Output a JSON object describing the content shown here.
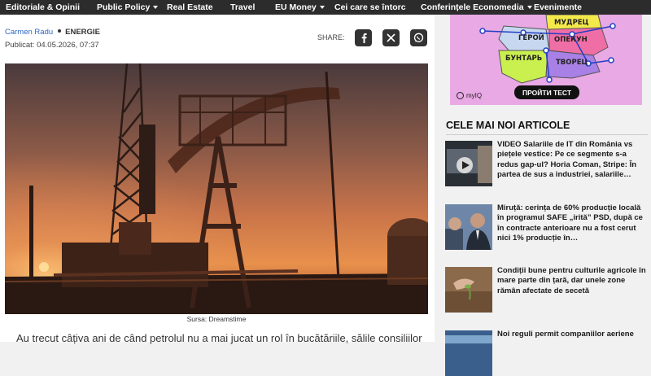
{
  "nav": {
    "items": [
      {
        "label": "Editoriale & Opinii",
        "dropdown": false
      },
      {
        "label": "Public Policy",
        "dropdown": true
      },
      {
        "label": "Real Estate",
        "dropdown": false
      },
      {
        "label": "Travel",
        "dropdown": false
      },
      {
        "label": "EU Money",
        "dropdown": true
      },
      {
        "label": "Cei care se întorc",
        "dropdown": false
      },
      {
        "label": "Conferințele Economedia",
        "dropdown": true
      },
      {
        "label": "Evenimente",
        "dropdown": false
      }
    ]
  },
  "article": {
    "author": "Carmen Radu",
    "category": "ENERGIE",
    "published": "Publicat: 04.05.2026, 07:37",
    "share_label": "SHARE:",
    "share_icons": [
      "facebook-icon",
      "x-icon",
      "whatsapp-icon"
    ],
    "image_caption": "Sursa: Dreamstime",
    "body_start": "Au trecut câțiva ani de când petrolul nu a mai jucat un rol în bucătăriile, sălile consiliilor"
  },
  "ad": {
    "regions": [
      "МУДРЕЦ",
      "ГЕРОЙ",
      "ОПЕКУН",
      "БУНТАРЬ",
      "ТВОРЕЦ"
    ],
    "button": "ПРОЙТИ ТЕСТ",
    "brand": "myIQ"
  },
  "sidebar": {
    "title": "CELE MAI NOI ARTICOLE",
    "articles": [
      {
        "title": "VIDEO Salariile de IT din România vs piețele vestice: Pe ce segmente s-a redus gap-ul? Horia Coman, Stripe: În partea de sus a industriei, salariile…"
      },
      {
        "title": "Miruță: cerința de 60% producție locală în programul SAFE „irită” PSD, după ce în contracte anterioare nu a fost cerut nici 1% producție în…"
      },
      {
        "title": "Condiții bune pentru culturile agricole în mare parte din țară, dar unele zone rămân afectate de secetă"
      },
      {
        "title": "Noi reguli permit companiilor aeriene"
      }
    ]
  },
  "colors": {
    "nav_bg": "#2c2c2c",
    "author": "#2f66c2",
    "ad_bg": "#e8a9e4"
  }
}
